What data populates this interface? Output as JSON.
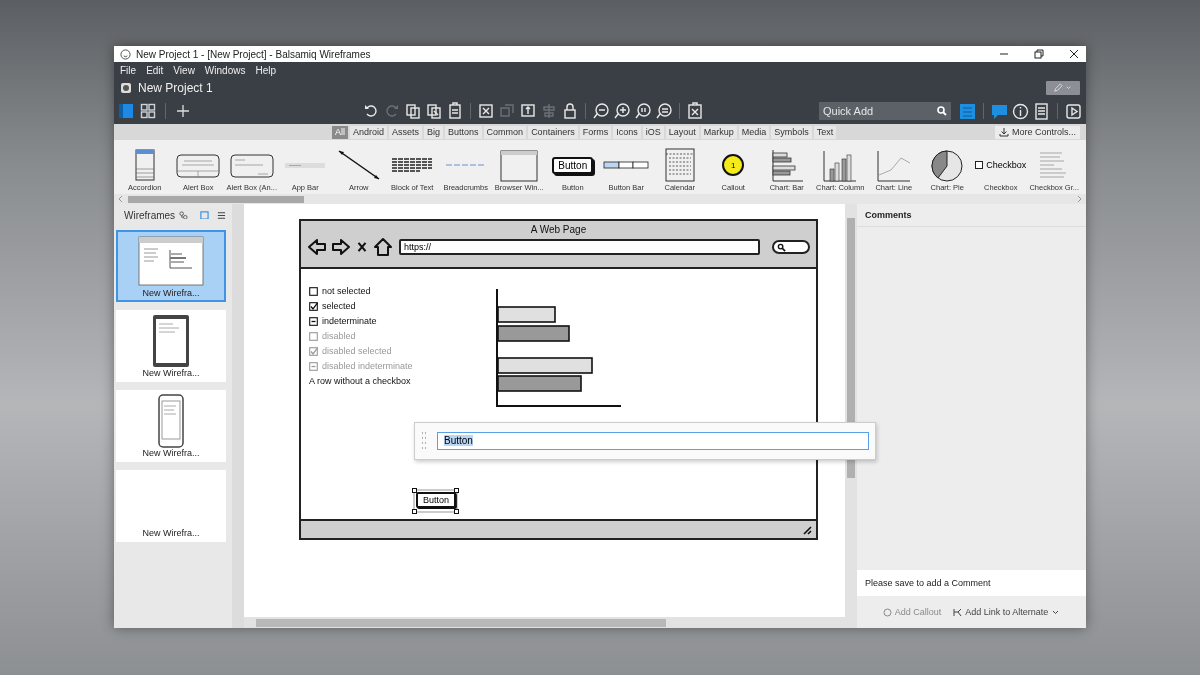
{
  "window": {
    "title": "New Project 1 - [New Project] - Balsamiq Wireframes"
  },
  "menu": [
    "File",
    "Edit",
    "View",
    "Windows",
    "Help"
  ],
  "project": {
    "title": "New Project 1"
  },
  "toolbar": {
    "view_modes": [
      {
        "kind": "single",
        "selected": true
      },
      {
        "kind": "grid",
        "selected": false
      }
    ],
    "tools": [
      {
        "kind": "undo",
        "disabled": false
      },
      {
        "kind": "redo",
        "disabled": true
      },
      {
        "kind": "copy",
        "disabled": false
      },
      {
        "kind": "duplicate",
        "disabled": false
      },
      {
        "kind": "clipboard",
        "disabled": false
      },
      {
        "kind": "group",
        "disabled": false
      },
      {
        "kind": "ungroup",
        "disabled": true
      },
      {
        "kind": "resize",
        "disabled": false
      },
      {
        "kind": "align",
        "disabled": true
      },
      {
        "kind": "lock",
        "disabled": false
      },
      {
        "kind": "zoom-out",
        "disabled": false
      },
      {
        "kind": "zoom-in",
        "disabled": false
      },
      {
        "kind": "zoom-actual",
        "disabled": false
      },
      {
        "kind": "zoom-fit",
        "disabled": false
      },
      {
        "kind": "delete",
        "disabled": false
      }
    ],
    "quick_add": {
      "placeholder": "Quick Add"
    },
    "panels": [
      {
        "kind": "properties",
        "selected": true
      },
      {
        "kind": "comments",
        "selected": true
      },
      {
        "kind": "info",
        "selected": false
      },
      {
        "kind": "list",
        "selected": false
      },
      {
        "kind": "present",
        "selected": false
      }
    ]
  },
  "categories": [
    {
      "label": "All",
      "selected": true
    },
    {
      "label": "Android",
      "selected": false
    },
    {
      "label": "Assets",
      "selected": false
    },
    {
      "label": "Big",
      "selected": false
    },
    {
      "label": "Buttons",
      "selected": false
    },
    {
      "label": "Common",
      "selected": false
    },
    {
      "label": "Containers",
      "selected": false
    },
    {
      "label": "Forms",
      "selected": false
    },
    {
      "label": "Icons",
      "selected": false
    },
    {
      "label": "iOS",
      "selected": false
    },
    {
      "label": "Layout",
      "selected": false
    },
    {
      "label": "Markup",
      "selected": false
    },
    {
      "label": "Media",
      "selected": false
    },
    {
      "label": "Symbols",
      "selected": false
    },
    {
      "label": "Text",
      "selected": false
    }
  ],
  "more_controls": "More Controls...",
  "library": [
    {
      "label": "Accordion",
      "kind": "accordion"
    },
    {
      "label": "Alert Box",
      "kind": "alert"
    },
    {
      "label": "Alert Box (An...",
      "kind": "alert-android"
    },
    {
      "label": "App Bar",
      "kind": "app-bar"
    },
    {
      "label": "Arrow",
      "kind": "arrow"
    },
    {
      "label": "Block of Text",
      "kind": "text-block"
    },
    {
      "label": "Breadcrumbs",
      "kind": "breadcrumbs"
    },
    {
      "label": "Browser Win...",
      "kind": "browser"
    },
    {
      "label": "Button",
      "kind": "button",
      "preview": "Button"
    },
    {
      "label": "Button Bar",
      "kind": "button-bar"
    },
    {
      "label": "Calendar",
      "kind": "calendar"
    },
    {
      "label": "Callout",
      "kind": "callout",
      "preview": "1"
    },
    {
      "label": "Chart: Bar",
      "kind": "chart-bar"
    },
    {
      "label": "Chart: Column",
      "kind": "chart-column"
    },
    {
      "label": "Chart: Line",
      "kind": "chart-line"
    },
    {
      "label": "Chart: Pie",
      "kind": "chart-pie"
    },
    {
      "label": "Checkbox",
      "kind": "checkbox",
      "preview": "Checkbox"
    },
    {
      "label": "Checkbox Gr...",
      "kind": "checkbox-group"
    }
  ],
  "wireframes": {
    "title": "Wireframes",
    "views": [
      {
        "kind": "thumbs",
        "selected": true
      },
      {
        "kind": "list",
        "selected": false
      }
    ],
    "pages": [
      {
        "label": "New Wirefra...",
        "kind": "browser",
        "selected": true
      },
      {
        "label": "New Wirefra...",
        "kind": "tablet",
        "selected": false
      },
      {
        "label": "New Wirefra...",
        "kind": "phone",
        "selected": false
      },
      {
        "label": "New Wirefra...",
        "kind": "blank",
        "selected": false
      }
    ]
  },
  "mockup": {
    "title": "A Web Page",
    "url": "https://",
    "checkboxes": [
      {
        "label": "not selected",
        "kind": "checkbox",
        "checked": false,
        "indeterminate": false,
        "disabled": false
      },
      {
        "label": "selected",
        "kind": "checkbox",
        "checked": true,
        "indeterminate": false,
        "disabled": false
      },
      {
        "label": "indeterminate",
        "kind": "checkbox",
        "checked": false,
        "indeterminate": true,
        "disabled": false
      },
      {
        "label": "disabled",
        "kind": "checkbox",
        "checked": false,
        "indeterminate": false,
        "disabled": true
      },
      {
        "label": "disabled selected",
        "kind": "checkbox",
        "checked": true,
        "indeterminate": false,
        "disabled": true
      },
      {
        "label": "disabled indeterminate",
        "kind": "checkbox",
        "checked": false,
        "indeterminate": true,
        "disabled": true
      },
      {
        "label": "A row without a checkbox",
        "kind": "text"
      }
    ],
    "edit_text": "Button",
    "button": "Button"
  },
  "comments": {
    "title": "Comments",
    "notice": "Please save to add a Comment",
    "actions": [
      {
        "label": "Add Callout",
        "kind": "callout",
        "disabled": true
      },
      {
        "label": "Add Link to Alternate",
        "kind": "link",
        "disabled": false
      }
    ]
  }
}
